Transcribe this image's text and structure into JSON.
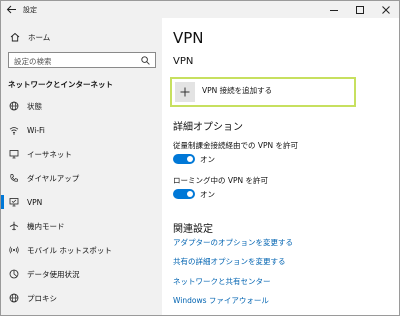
{
  "window": {
    "title": "設定"
  },
  "sidebar": {
    "home_label": "ホーム",
    "search_placeholder": "設定の検索",
    "section_title": "ネットワークとインターネット",
    "items": [
      {
        "label": "状態",
        "icon": "globe-icon"
      },
      {
        "label": "Wi-Fi",
        "icon": "wifi-icon"
      },
      {
        "label": "イーサネット",
        "icon": "ethernet-icon"
      },
      {
        "label": "ダイヤルアップ",
        "icon": "phone-icon"
      },
      {
        "label": "VPN",
        "icon": "vpn-icon",
        "active": true
      },
      {
        "label": "機内モード",
        "icon": "airplane-icon"
      },
      {
        "label": "モバイル ホットスポット",
        "icon": "hotspot-icon"
      },
      {
        "label": "データ使用状況",
        "icon": "data-usage-icon"
      },
      {
        "label": "プロキシ",
        "icon": "globe-icon"
      }
    ]
  },
  "main": {
    "page_title": "VPN",
    "vpn_section_title": "VPN",
    "add_vpn_label": "VPN 接続を追加する",
    "advanced_title": "詳細オプション",
    "options": [
      {
        "label": "従量制課金接続経由での VPN を許可",
        "state": "オン",
        "on": true
      },
      {
        "label": "ローミング中の VPN を許可",
        "state": "オン",
        "on": true
      }
    ],
    "related_title": "関連設定",
    "links": [
      "アダプターのオプションを変更する",
      "共有の詳細オプションを変更する",
      "ネットワークと共有センター",
      "Windows ファイアウォール"
    ]
  },
  "colors": {
    "accent": "#0078d7",
    "link": "#0063b1",
    "focus_border": "#c7e05f",
    "sidebar_bg": "#f1f1f1"
  }
}
